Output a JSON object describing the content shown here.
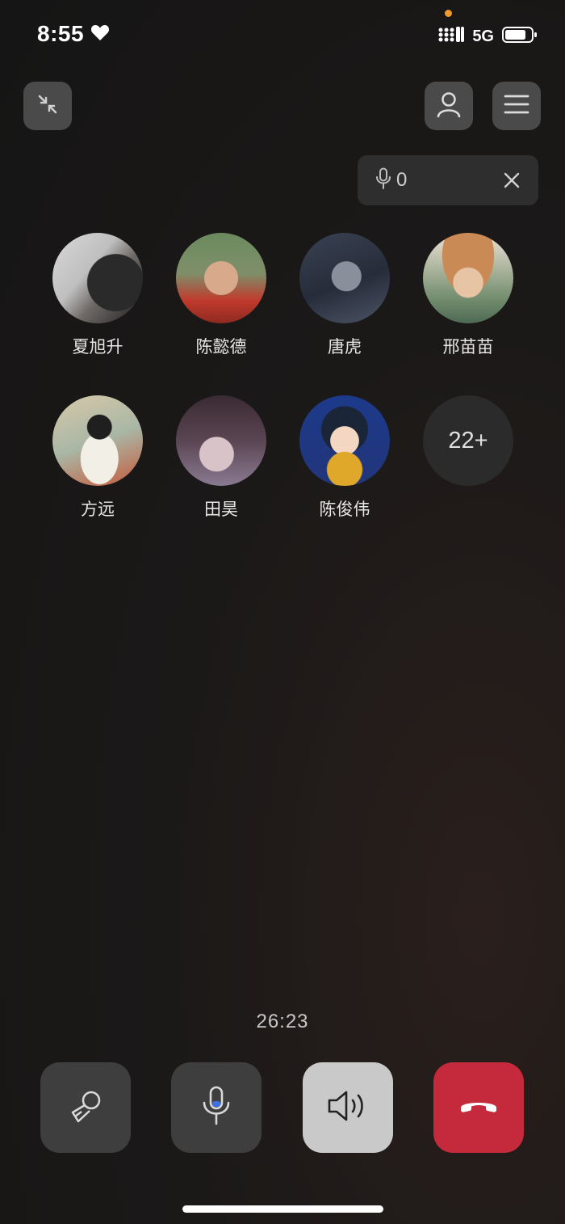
{
  "status_bar": {
    "time": "8:55",
    "network": "5G",
    "colors": {
      "indicator": "#f09a2a"
    }
  },
  "mic_pill": {
    "count": "0"
  },
  "participants": [
    {
      "name": "夏旭升"
    },
    {
      "name": "陈懿德"
    },
    {
      "name": "唐虎"
    },
    {
      "name": "邢苗苗"
    },
    {
      "name": "方远"
    },
    {
      "name": "田昊"
    },
    {
      "name": "陈俊伟"
    }
  ],
  "more_count": "22+",
  "call_timer": "26:23",
  "colors": {
    "hangup": "#c42a3c",
    "speaker_active": "#c9c9c9",
    "control": "#3e3e3e"
  }
}
